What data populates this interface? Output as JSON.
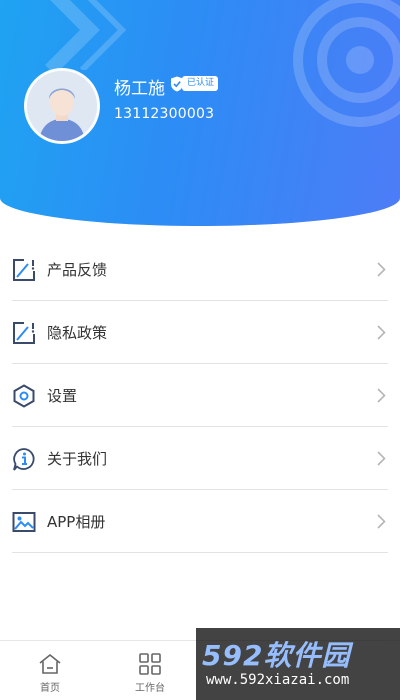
{
  "profile": {
    "name": "杨工施",
    "verified_label": "已认证",
    "phone": "13112300003"
  },
  "menu": {
    "items": [
      {
        "label": "产品反馈",
        "icon": "feedback-icon"
      },
      {
        "label": "隐私政策",
        "icon": "privacy-icon"
      },
      {
        "label": "设置",
        "icon": "settings-icon"
      },
      {
        "label": "关于我们",
        "icon": "info-icon"
      },
      {
        "label": "APP相册",
        "icon": "album-icon"
      }
    ]
  },
  "tabbar": {
    "tabs": [
      {
        "label": "首页",
        "icon": "home-icon"
      },
      {
        "label": "工作台",
        "icon": "grid-icon"
      },
      {
        "label": "",
        "icon": "hidden-tab-icon"
      },
      {
        "label": "",
        "icon": "hidden-tab-icon"
      }
    ]
  },
  "watermark": {
    "brand": "592软件园",
    "url": "www.592xiazai.com"
  },
  "colors": {
    "header_start": "#1fa3f2",
    "header_end": "#4d7cf7",
    "icon": "#3a4a6b",
    "accent": "#2d8cf5"
  }
}
